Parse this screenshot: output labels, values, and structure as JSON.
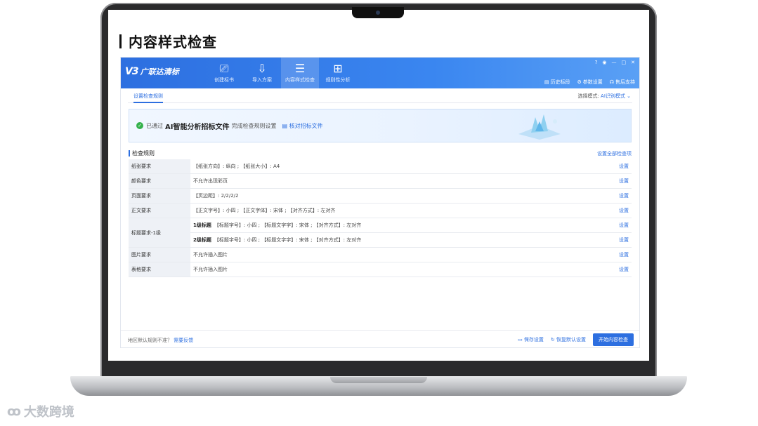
{
  "slide": {
    "title": "内容样式检查"
  },
  "app": {
    "logo_badge": "V3",
    "logo_text": "广联达清标",
    "nav": [
      {
        "label": "创建标书",
        "icon": "monitor-icon"
      },
      {
        "label": "导入方案",
        "icon": "import-icon"
      },
      {
        "label": "内容样式检查",
        "icon": "document-list-icon"
      },
      {
        "label": "规则性分析",
        "icon": "grid-icon"
      }
    ],
    "win_controls": [
      "?",
      "◉",
      "—",
      "□",
      "✕"
    ],
    "top_links": [
      {
        "label": "历史标段",
        "icon": "folder-icon"
      },
      {
        "label": "参数设置",
        "icon": "gear-icon"
      },
      {
        "label": "售后支持",
        "icon": "headset-icon"
      }
    ],
    "tab": "设置检查规则",
    "mode_label": "选择模式:",
    "mode_value": "AI识别模式 ⌄",
    "banner": {
      "pre": "已通过",
      "strong": "AI智能分析招标文件",
      "post": "完成检查规则设置",
      "link": "核对招标文件"
    },
    "rules_title": "检查规则",
    "rules_all": "设置全部检查项",
    "set_label": "设置",
    "rules": [
      {
        "name": "纸张要求",
        "lines": [
          {
            "head": "",
            "text": "【纸张方向】: 纵向 ; 【纸张大小】: A4"
          }
        ]
      },
      {
        "name": "颜色要求",
        "lines": [
          {
            "head": "",
            "text": "不允许出现彩页"
          }
        ]
      },
      {
        "name": "页面要求",
        "lines": [
          {
            "head": "",
            "text": "【页边距】: 2/2/2/2"
          }
        ]
      },
      {
        "name": "正文要求",
        "lines": [
          {
            "head": "",
            "text": "【正文字号】: 小四 ; 【正文字体】: 宋体 ; 【对齐方式】: 左对齐"
          }
        ]
      },
      {
        "name": "标题要求-1级",
        "lines": [
          {
            "head": "1级标题",
            "text": "【标题字号】: 小四 ; 【标题文字字】: 宋体 ; 【对齐方式】: 左对齐"
          },
          {
            "head": "2级标题",
            "text": "【标题字号】: 小四 ; 【标题文字字】: 宋体 ; 【对齐方式】: 左对齐"
          }
        ]
      },
      {
        "name": "图片要求",
        "lines": [
          {
            "head": "",
            "text": "不允许插入图片"
          }
        ]
      },
      {
        "name": "表格要求",
        "lines": [
          {
            "head": "",
            "text": "不允许插入图片"
          }
        ]
      }
    ],
    "footer": {
      "question": "地区默认规则不准？",
      "feedback": "需要反馈",
      "save": "保存设置",
      "reset": "恢复默认设置",
      "start": "开始内容检查"
    },
    "colors": {
      "accent": "#2d6fe0",
      "success": "#34b14b"
    }
  },
  "watermark": "大数跨境"
}
